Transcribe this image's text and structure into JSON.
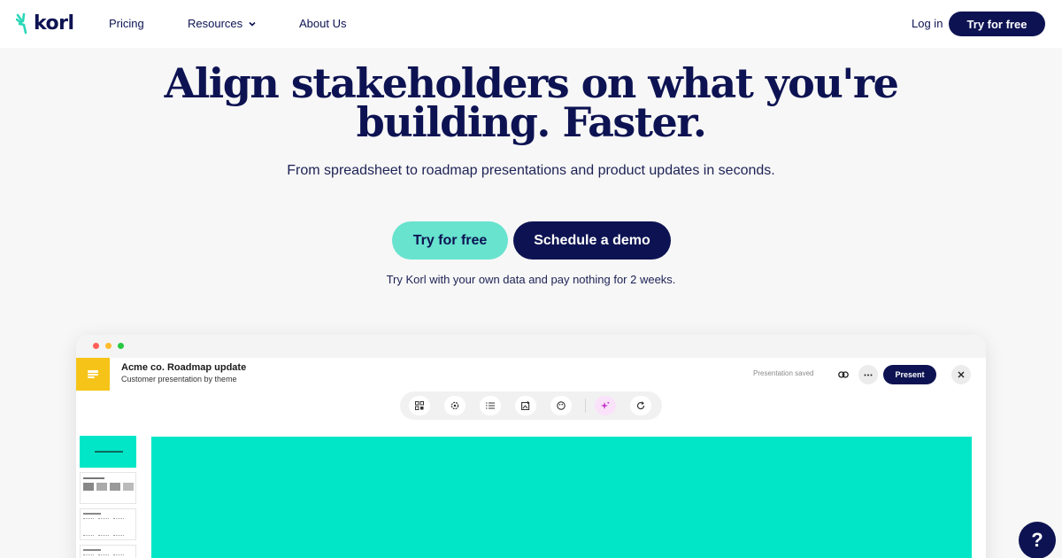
{
  "brand": {
    "name": "korl",
    "accent": "#67e3ce",
    "navy": "#0d1352"
  },
  "nav": {
    "links": [
      "Pricing",
      "Resources",
      "About Us"
    ],
    "login": "Log in",
    "cta": "Try for free"
  },
  "hero": {
    "title_line1": "Align stakeholders on what you're",
    "title_line2": "building. Faster.",
    "subtitle": "From spreadsheet to roadmap presentations and product updates in seconds.",
    "primary_cta": "Try for free",
    "secondary_cta": "Schedule a demo",
    "note": "Try Korl with your own data and pay nothing for 2 weeks."
  },
  "app": {
    "doc_title": "Acme co. Roadmap update",
    "doc_subtitle": "Customer presentation by theme",
    "status": "Presentation saved",
    "present_label": "Present",
    "toolbar_icons": [
      "grid-icon",
      "settings-icon",
      "list-icon",
      "image-icon",
      "palette-icon",
      "sparkle-icon",
      "refresh-icon"
    ],
    "canvas_color": "#00e6c6"
  },
  "help": {
    "label": "?"
  }
}
